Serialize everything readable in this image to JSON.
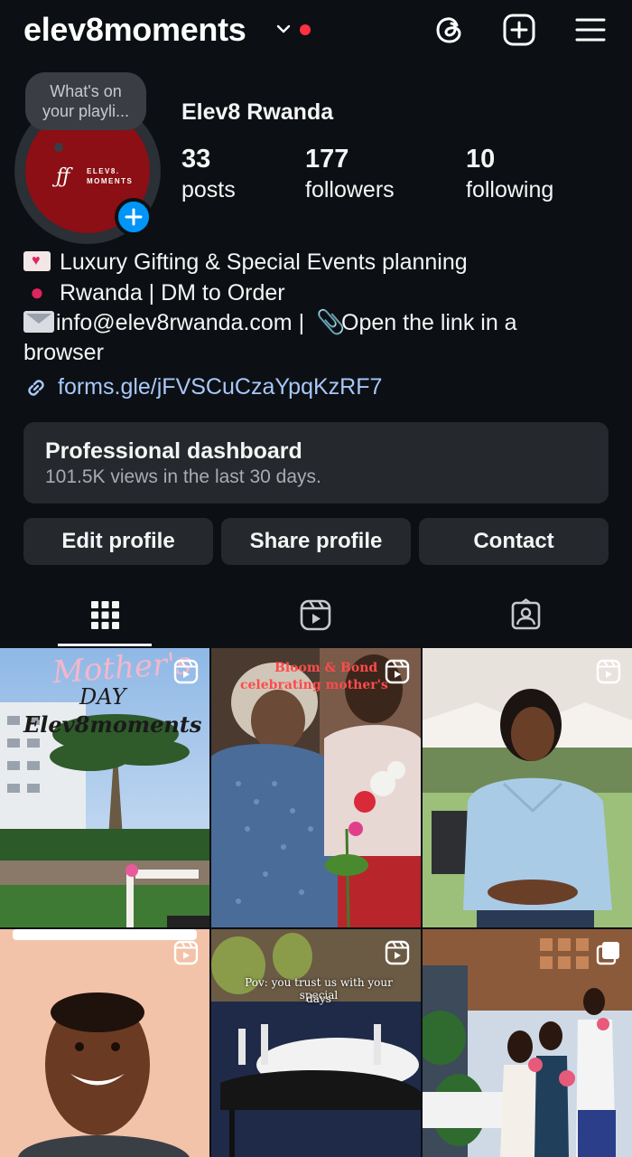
{
  "header": {
    "username": "elev8moments",
    "colors": {
      "notification_dot": "#ff3040",
      "accent": "#0095f6",
      "link": "#a8c7fa"
    }
  },
  "profile": {
    "display_name": "Elev8 Rwanda",
    "note": "What's on your playli...",
    "avatar_logo": {
      "mark": "ƒƒ",
      "line1": "ELEV8.",
      "line2": "MOMENTS"
    },
    "stats": [
      {
        "value": "33",
        "label": "posts"
      },
      {
        "value": "177",
        "label": "followers"
      },
      {
        "value": "10",
        "label": "following"
      }
    ],
    "bio": {
      "line1": "Luxury Gifting & Special Events planning",
      "line2": "Rwanda | DM to Order",
      "line3a": "info@elev8rwanda.com | ",
      "line3b": "Open the link in a",
      "line4": "browser"
    },
    "link": "forms.gle/jFVSCuCzaYpqKzRF7"
  },
  "dashboard": {
    "title": "Professional dashboard",
    "subtitle": "101.5K views in the last 30 days."
  },
  "buttons": {
    "edit": "Edit profile",
    "share": "Share profile",
    "contact": "Contact"
  },
  "tabs": [
    {
      "icon": "grid-icon",
      "active": true
    },
    {
      "icon": "reels-icon",
      "active": false
    },
    {
      "icon": "tagged-icon",
      "active": false
    }
  ],
  "posts": {
    "p1": {
      "line1": "Mother's",
      "line2": "DAY",
      "line3": "Elev8moments"
    },
    "p2": {
      "line1": "Bloom & Bond",
      "line2": "celebrating mother's"
    },
    "p5": {
      "line1": "Pov: you trust us with your special",
      "line2": "days"
    }
  }
}
